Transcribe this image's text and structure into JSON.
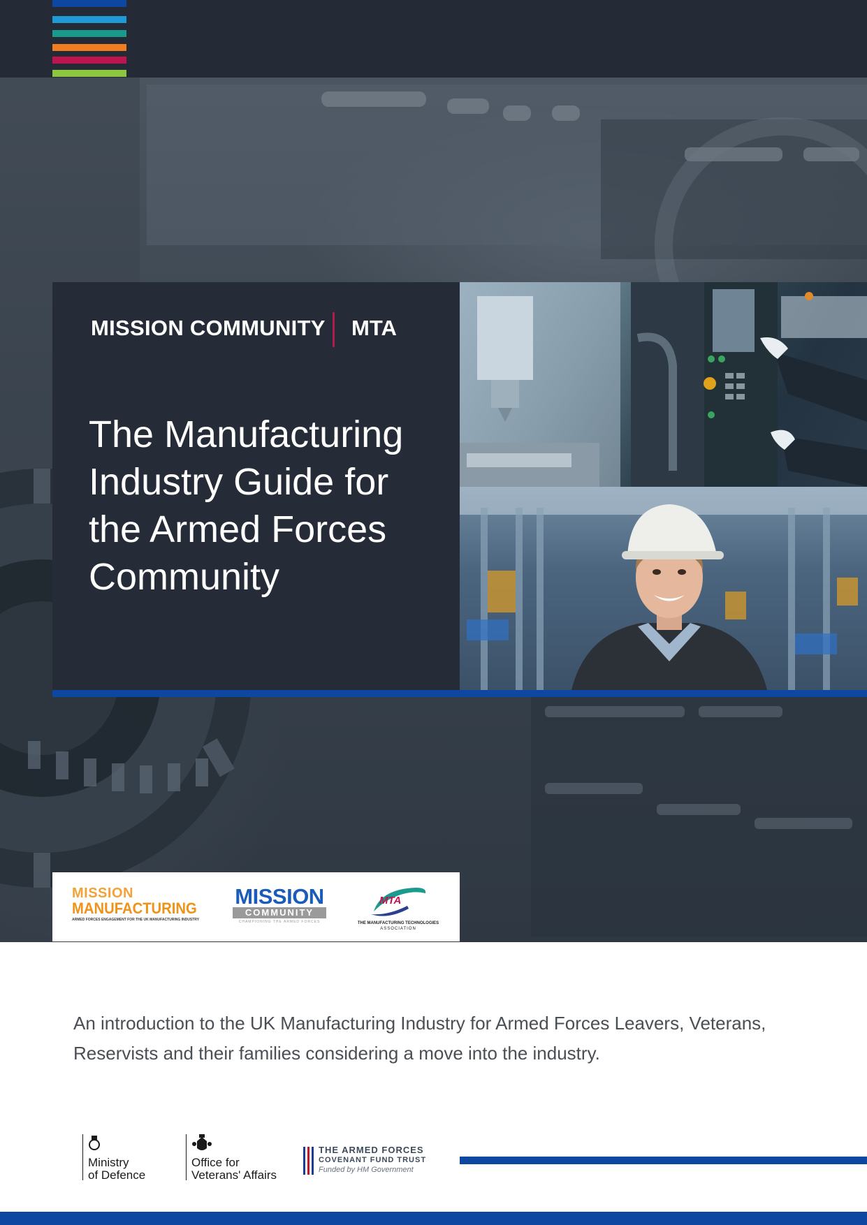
{
  "brand": {
    "left": "MISSION COMMUNITY",
    "right": "MTA"
  },
  "title": "The Manufacturing Industry Guide for the Armed Forces Community",
  "intro": "An introduction to the UK Manufacturing Industry for Armed Forces Leavers, Veterans, Reservists and their families considering a move into the industry.",
  "logos": {
    "mission_manufacturing": {
      "line1": "MISSION",
      "line2": "MANUFACTURING",
      "tagline": "ARMED FORCES ENGAGEMENT FOR THE UK MANUFACTURING INDUSTRY"
    },
    "mission_community": {
      "line1": "MISSION",
      "line2": "COMMUNITY",
      "tagline": "CHAMPIONING THE ARMED FORCES"
    },
    "mta": {
      "mark": "MTA",
      "line1": "THE MANUFACTURING TECHNOLOGIES",
      "line2": "ASSOCIATION"
    }
  },
  "partners": {
    "mod": {
      "line1": "Ministry",
      "line2": "of Defence"
    },
    "ova": {
      "line1": "Office for",
      "line2": "Veterans' Affairs"
    },
    "covenant": {
      "line1": "THE ARMED FORCES",
      "line2": "COVENANT FUND TRUST",
      "line3": "Funded by HM Government"
    }
  },
  "colors": {
    "stripes": [
      "#0d47a1",
      "#1e9bd7",
      "#1a9a8a",
      "#f07d1f",
      "#c0144f",
      "#8dc63f"
    ],
    "accent_blue": "#0d47a1",
    "dark": "#252c37",
    "divider": "#b01c4b"
  },
  "icons": [
    "crest-icon",
    "crest-icon",
    "flag-stripes-icon"
  ]
}
